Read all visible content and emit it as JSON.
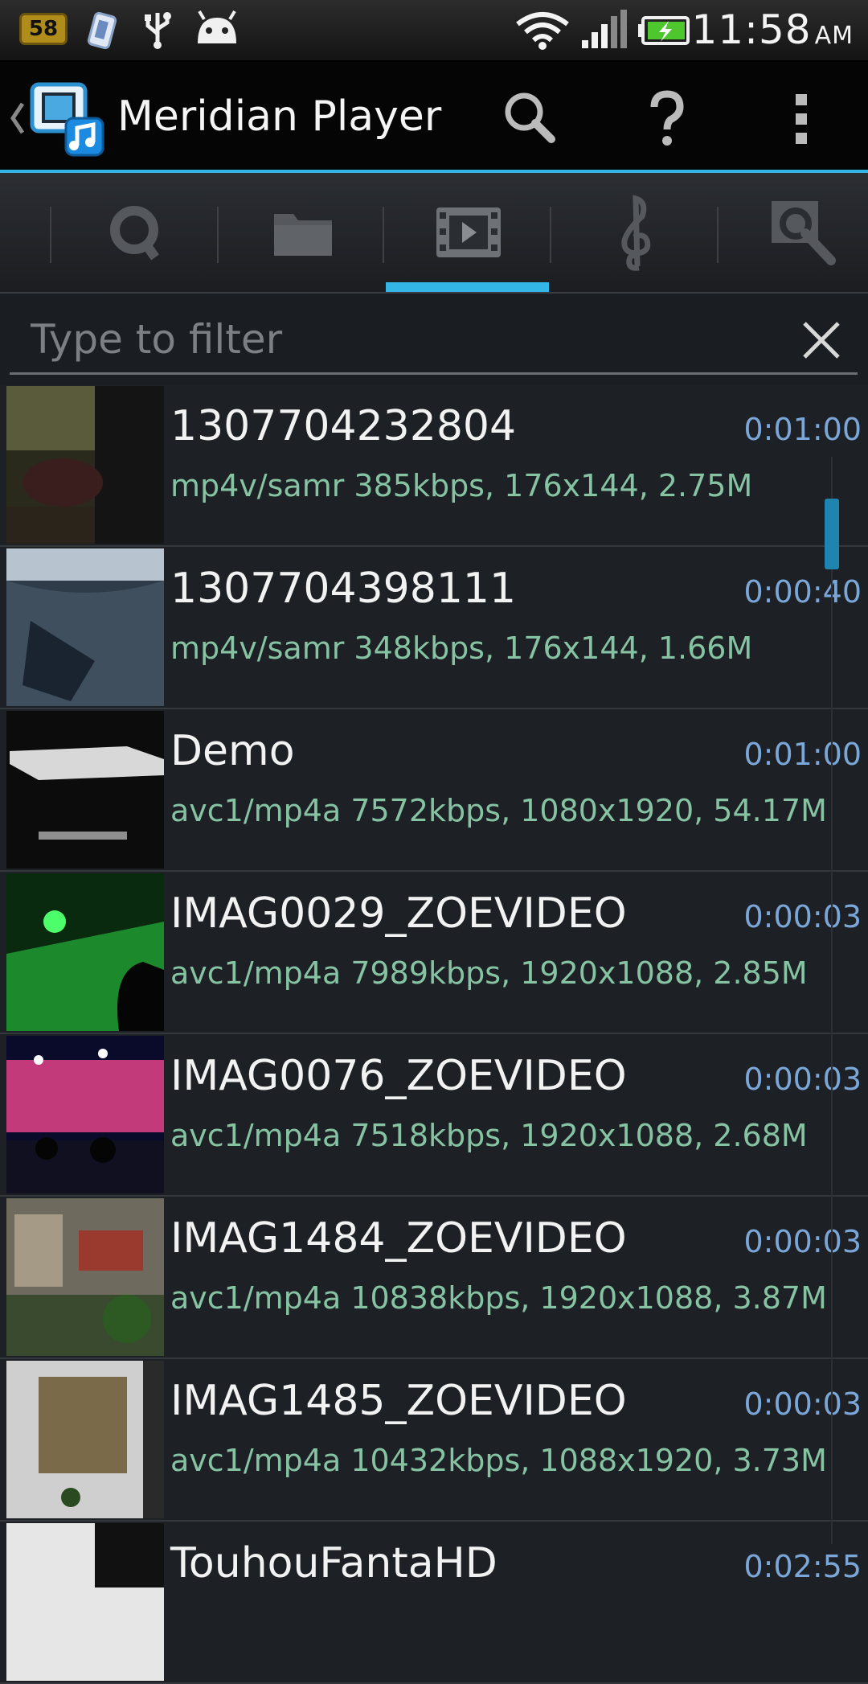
{
  "status_bar": {
    "battery_level": "58",
    "time": "11:58",
    "ampm": "AM"
  },
  "action_bar": {
    "title": "Meridian Player"
  },
  "tabs": [
    {
      "name": "queue",
      "icon": "queue-icon"
    },
    {
      "name": "folders",
      "icon": "folder-icon"
    },
    {
      "name": "videos",
      "icon": "film-icon",
      "selected": true
    },
    {
      "name": "music",
      "icon": "treble-clef-icon"
    },
    {
      "name": "search",
      "icon": "search-tab-icon"
    }
  ],
  "filter": {
    "placeholder": "Type to filter",
    "value": ""
  },
  "videos": [
    {
      "title": "1307704232804",
      "info": "mp4v/samr 385kbps, 176x144, 2.75M",
      "duration": "0:01:00"
    },
    {
      "title": "1307704398111",
      "info": "mp4v/samr 348kbps, 176x144, 1.66M",
      "duration": "0:00:40"
    },
    {
      "title": "Demo",
      "info": "avc1/mp4a 7572kbps, 1080x1920, 54.17M",
      "duration": "0:01:00"
    },
    {
      "title": "IMAG0029_ZOEVIDEO",
      "info": "avc1/mp4a 7989kbps, 1920x1088, 2.85M",
      "duration": "0:00:03"
    },
    {
      "title": "IMAG0076_ZOEVIDEO",
      "info": "avc1/mp4a 7518kbps, 1920x1088, 2.68M",
      "duration": "0:00:03"
    },
    {
      "title": "IMAG1484_ZOEVIDEO",
      "info": "avc1/mp4a 10838kbps, 1920x1088, 3.87M",
      "duration": "0:00:03"
    },
    {
      "title": "IMAG1485_ZOEVIDEO",
      "info": "avc1/mp4a 10432kbps, 1088x1920, 3.73M",
      "duration": "0:00:03"
    },
    {
      "title": "TouhouFantaHD",
      "info": "",
      "duration": "0:02:55"
    }
  ],
  "colors": {
    "accent": "#33b5e5",
    "info_text": "#86c3a3",
    "duration_text": "#7aa6d8"
  }
}
